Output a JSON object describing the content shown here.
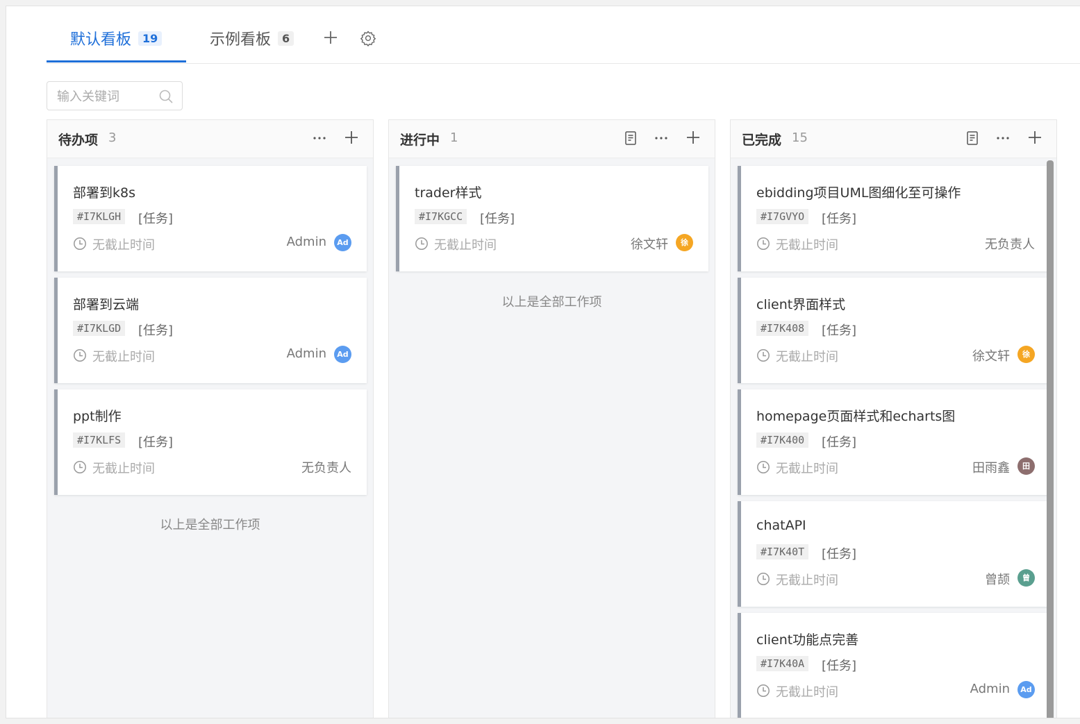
{
  "tabs": [
    {
      "label": "默认看板",
      "count": "19",
      "active": true
    },
    {
      "label": "示例看板",
      "count": "6",
      "active": false
    }
  ],
  "tab_actions": {
    "add_icon": "plus-icon",
    "settings_icon": "gear-icon"
  },
  "search": {
    "placeholder": "输入关键词",
    "value": "",
    "icon": "search-icon"
  },
  "columns": [
    {
      "title": "待办项",
      "count": "3",
      "cards": [
        {
          "title": "部署到k8s",
          "code": "#I7KLGH",
          "type": "[任务]",
          "due": "无截止时间",
          "owner": "Admin",
          "avatar": "Ad",
          "avatar_color": "#5b9cf0"
        },
        {
          "title": "部署到云端",
          "code": "#I7KLGD",
          "type": "[任务]",
          "due": "无截止时间",
          "owner": "Admin",
          "avatar": "Ad",
          "avatar_color": "#5b9cf0"
        },
        {
          "title": "ppt制作",
          "code": "#I7KLFS",
          "type": "[任务]",
          "due": "无截止时间",
          "owner": "无负责人",
          "avatar": "",
          "avatar_color": ""
        }
      ],
      "end_note": "以上是全部工作项"
    },
    {
      "title": "进行中",
      "count": "1",
      "cards": [
        {
          "title": "trader样式",
          "code": "#I7KGCC",
          "type": "[任务]",
          "due": "无截止时间",
          "owner": "徐文轩",
          "avatar": "徐",
          "avatar_color": "#f5a623"
        }
      ],
      "end_note": "以上是全部工作项"
    },
    {
      "title": "已完成",
      "count": "15",
      "cards": [
        {
          "title": "ebidding项目UML图细化至可操作",
          "code": "#I7GVYO",
          "type": "[任务]",
          "due": "无截止时间",
          "owner": "无负责人",
          "avatar": "",
          "avatar_color": ""
        },
        {
          "title": "client界面样式",
          "code": "#I7K408",
          "type": "[任务]",
          "due": "无截止时间",
          "owner": "徐文轩",
          "avatar": "徐",
          "avatar_color": "#f5a623"
        },
        {
          "title": "homepage页面样式和echarts图",
          "code": "#I7K400",
          "type": "[任务]",
          "due": "无截止时间",
          "owner": "田雨鑫",
          "avatar": "田",
          "avatar_color": "#8d6e6e"
        },
        {
          "title": "chatAPI",
          "code": "#I7K40T",
          "type": "[任务]",
          "due": "无截止时间",
          "owner": "曾颉",
          "avatar": "曾",
          "avatar_color": "#5a9f8f"
        },
        {
          "title": "client功能点完善",
          "code": "#I7K40A",
          "type": "[任务]",
          "due": "无截止时间",
          "owner": "Admin",
          "avatar": "Ad",
          "avatar_color": "#5b9cf0"
        }
      ]
    }
  ]
}
